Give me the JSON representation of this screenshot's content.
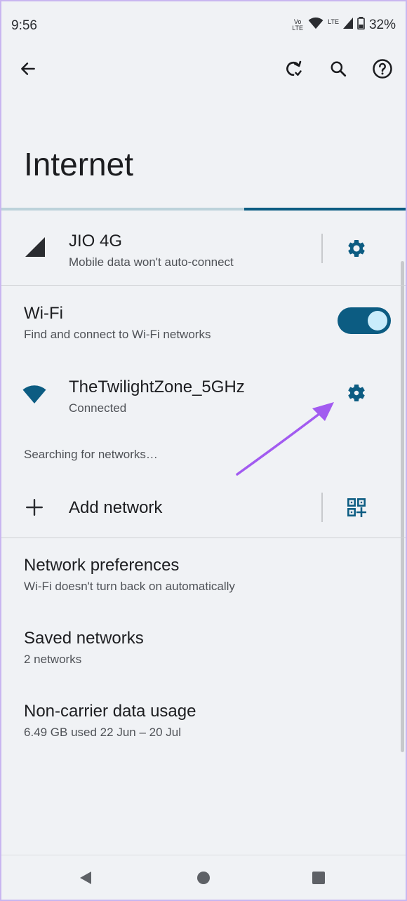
{
  "status_bar": {
    "time": "9:56",
    "volte": "Vo LTE",
    "lte": "LTE",
    "battery": "32%"
  },
  "toolbar": {
    "back_icon": "arrow-left-icon",
    "refresh_icon": "refresh-icon",
    "search_icon": "search-icon",
    "help_icon": "help-icon"
  },
  "page": {
    "title": "Internet"
  },
  "mobile": {
    "name": "JIO 4G",
    "status": "Mobile data won't auto-connect"
  },
  "wifi": {
    "title": "Wi-Fi",
    "subtitle": "Find and connect to Wi-Fi networks",
    "enabled": true
  },
  "network": {
    "name": "TheTwilightZone_5GHz",
    "status": "Connected"
  },
  "searching": "Searching for networks…",
  "add_network": {
    "label": "Add network"
  },
  "settings": [
    {
      "title": "Network preferences",
      "subtitle": "Wi-Fi doesn't turn back on automatically"
    },
    {
      "title": "Saved networks",
      "subtitle": "2 networks"
    },
    {
      "title": "Non-carrier data usage",
      "subtitle": "6.49 GB used 22 Jun – 20 Jul"
    }
  ],
  "colors": {
    "accent": "#0c5c82",
    "annotation_arrow": "#a25bf0"
  }
}
